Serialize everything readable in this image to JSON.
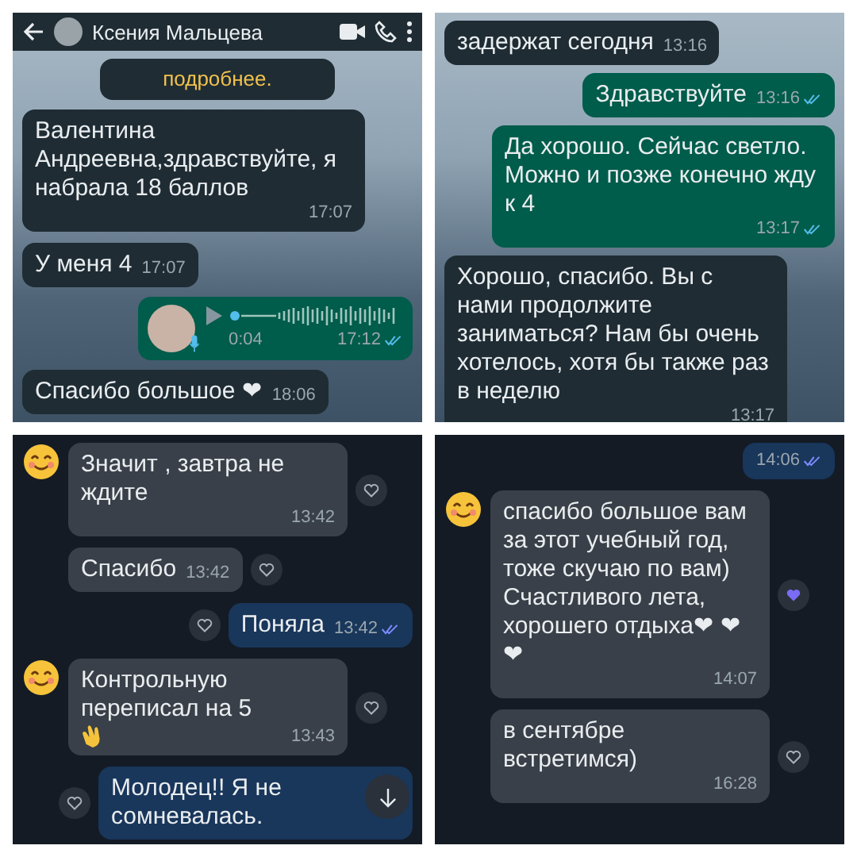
{
  "panels": [
    {
      "kind": "whatsapp",
      "header": {
        "name": "Ксения Мальцева"
      },
      "messages": [
        {
          "kind": "notice",
          "text": "подробнее."
        },
        {
          "kind": "incoming",
          "text": "Валентина Андреевна,здравствуйте, я набрала 18 баллов",
          "time": "17:07"
        },
        {
          "kind": "incoming",
          "text": "У меня 4",
          "time": "17:07"
        },
        {
          "kind": "voice",
          "text": "0:04",
          "time": "17:12",
          "read": true
        },
        {
          "kind": "incoming",
          "text": "Спасибо большое ❤",
          "time": "18:06"
        }
      ]
    },
    {
      "kind": "whatsapp",
      "messages": [
        {
          "kind": "incoming",
          "text": "задержат сегодня",
          "time": "13:16"
        },
        {
          "kind": "outgoing",
          "text": "Здравствуйте",
          "time": "13:16",
          "read": true
        },
        {
          "kind": "outgoing",
          "text": "Да хорошо. Сейчас светло. Можно и позже конечно  жду к 4",
          "time": "13:17",
          "read": true
        },
        {
          "kind": "incoming",
          "text": "Хорошо, спасибо. Вы с нами продолжите заниматься? Нам бы очень хотелось, хотя бы также раз в неделю",
          "time": "13:17"
        }
      ]
    },
    {
      "kind": "vk",
      "scroll_button": true,
      "messages": [
        {
          "kind": "incoming",
          "text": "Значит , завтра не ждите",
          "time": "13:42",
          "avatar": true,
          "reacted": false
        },
        {
          "kind": "incoming",
          "text": "Спасибо",
          "time": "13:42",
          "reacted": false
        },
        {
          "kind": "outgoing",
          "text": "Поняла",
          "time": "13:42",
          "read": true,
          "reacted": false
        },
        {
          "kind": "incoming",
          "text": "Контрольную переписал на 5",
          "time": "13:43",
          "avatar": true,
          "reacted": false,
          "clap": true
        },
        {
          "kind": "outgoing",
          "text": "Молодец!! Я не сомневалась.",
          "reacted": false
        }
      ]
    },
    {
      "kind": "vk",
      "messages": [
        {
          "kind": "outgoing",
          "time": "14:06",
          "read": true
        },
        {
          "kind": "incoming",
          "text": "спасибо большое вам за этот учебный год, тоже скучаю по вам) Счастливого лета, хорошего отдыха❤ ❤❤",
          "time": "14:07",
          "avatar": true,
          "reacted": true
        },
        {
          "kind": "incoming",
          "text": "в сентябре встретимся)",
          "time": "16:28",
          "reacted": false
        }
      ]
    }
  ]
}
